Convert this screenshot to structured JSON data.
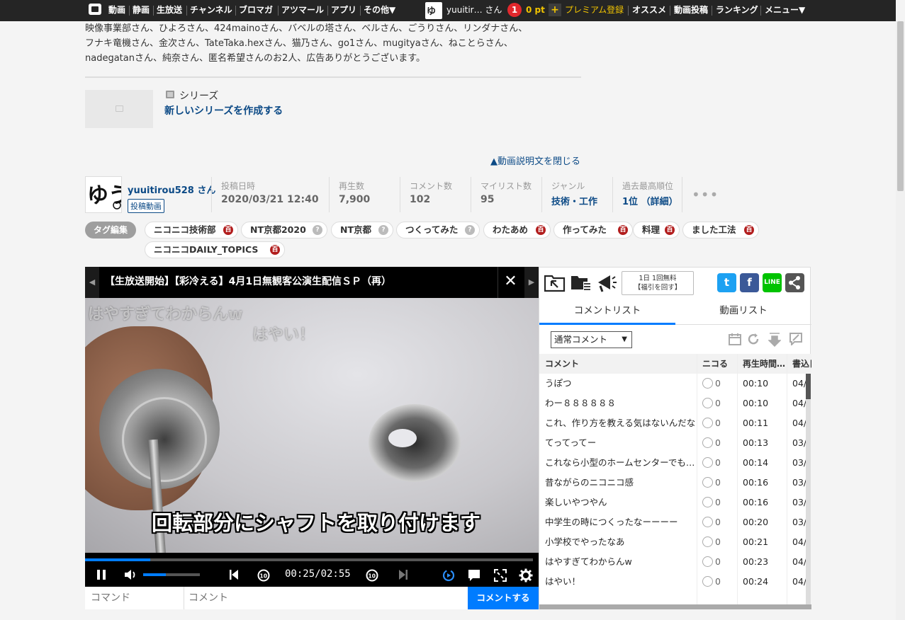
{
  "topnav": {
    "items": [
      "動画",
      "静画",
      "生放送",
      "チャンネル",
      "ブロマガ",
      "アツマール",
      "アプリ",
      "その他▼"
    ],
    "username": "yuuitir… さん",
    "notification_count": "1",
    "points": "0 pt",
    "premium": "プレミアム登録",
    "right_items": [
      "オススメ",
      "動画投稿",
      "ランキング",
      "メニュー▼"
    ],
    "colors": {
      "bar": "#252525",
      "premium": "#f2c400",
      "notif": "#e2282d"
    }
  },
  "description": {
    "lines": [
      "映像事業部さん、ひよろさん、424mainoさん、バベルの塔さん、ベルさん、ごうりさん、リンダナさん、",
      "フナキ竜機さん、金次さん、TateTaka.hexさん、猫乃さん、go1さん、mugityaさん、ねことらさん、",
      "nadegatanさん、純奈さん、匿名希望さんのお2人、広告ありがとうございます。"
    ],
    "series_label": "シリーズ",
    "series_create": "新しいシリーズを作成する",
    "close_link": "▲動画説明文を閉じる"
  },
  "video_info": {
    "owner_name": "yuuitirou528 さん",
    "owner_badge": "投稿動画",
    "meta": [
      {
        "label": "投稿日時",
        "value": "2020/03/21 12:40"
      },
      {
        "label": "再生数",
        "value": "7,900"
      },
      {
        "label": "コメント数",
        "value": "102"
      },
      {
        "label": "マイリスト数",
        "value": "95"
      },
      {
        "label": "ジャンル",
        "value": "技術・工作"
      },
      {
        "label": "過去最高順位",
        "value": "1位 （詳細）"
      }
    ],
    "more": "•••"
  },
  "tags": {
    "edit_label": "タグ編集",
    "items": [
      {
        "label": "ニコニコ技術部",
        "icon": "dic"
      },
      {
        "label": "NT京都2020",
        "icon": "q"
      },
      {
        "label": "NT京都",
        "icon": "q"
      },
      {
        "label": "つくってみた",
        "icon": "q"
      },
      {
        "label": "わたあめ",
        "icon": "dic"
      },
      {
        "label": "作ってみた",
        "icon": "dic"
      },
      {
        "label": "料理",
        "icon": "dic"
      },
      {
        "label": "ました工法",
        "icon": "dic"
      },
      {
        "label": "ニコニコDAILY_TOPICS",
        "icon": "dic"
      }
    ],
    "dic_glyph": "百",
    "q_glyph": "?"
  },
  "player": {
    "title": "【生放送開始】【彩冷える】4月1日無観客公演生配信ＳＰ（再）",
    "close": "✕",
    "floating_comments": [
      "はやすぎてわからんw",
      "はやい！"
    ],
    "subtitle": "回転部分にシャフトを取り付けます",
    "time": "00:25/02:55",
    "progress": 0.145,
    "volume": 0.4,
    "command_placeholder": "コマンド",
    "comment_placeholder": "コメント",
    "comment_button": "コメントする",
    "accent": "#007cff"
  },
  "panel": {
    "ad_text_1": "1日 1回無料",
    "ad_text_2": "【福引を回す】",
    "tabs": [
      "コメントリスト",
      "動画リスト"
    ],
    "filter": "通常コメント",
    "columns": [
      "コメント",
      "ニコる",
      "再生時間…",
      "書込日"
    ],
    "rows": [
      {
        "comment": "うぽつ",
        "nicoru": "0",
        "time": "00:10",
        "date": "04/"
      },
      {
        "comment": "わー８８８８８８",
        "nicoru": "0",
        "time": "00:10",
        "date": "04/"
      },
      {
        "comment": "これ、作り方を教える気はないんだな",
        "nicoru": "0",
        "time": "00:11",
        "date": "04/"
      },
      {
        "comment": "てってってー",
        "nicoru": "0",
        "time": "00:13",
        "date": "03/"
      },
      {
        "comment": "これなら小型のホームセンターでも…",
        "nicoru": "0",
        "time": "00:14",
        "date": "03/"
      },
      {
        "comment": "昔ながらのニコニコ感",
        "nicoru": "0",
        "time": "00:16",
        "date": "03/"
      },
      {
        "comment": "楽しいやつやん",
        "nicoru": "0",
        "time": "00:16",
        "date": "03/"
      },
      {
        "comment": "中学生の時につくったなーーーー",
        "nicoru": "0",
        "time": "00:20",
        "date": "03/"
      },
      {
        "comment": "小学校でやったなあ",
        "nicoru": "0",
        "time": "00:21",
        "date": "04/"
      },
      {
        "comment": "はやすぎてわからんw",
        "nicoru": "0",
        "time": "00:23",
        "date": "04/"
      },
      {
        "comment": "はやい！",
        "nicoru": "0",
        "time": "00:24",
        "date": "04/"
      }
    ]
  }
}
